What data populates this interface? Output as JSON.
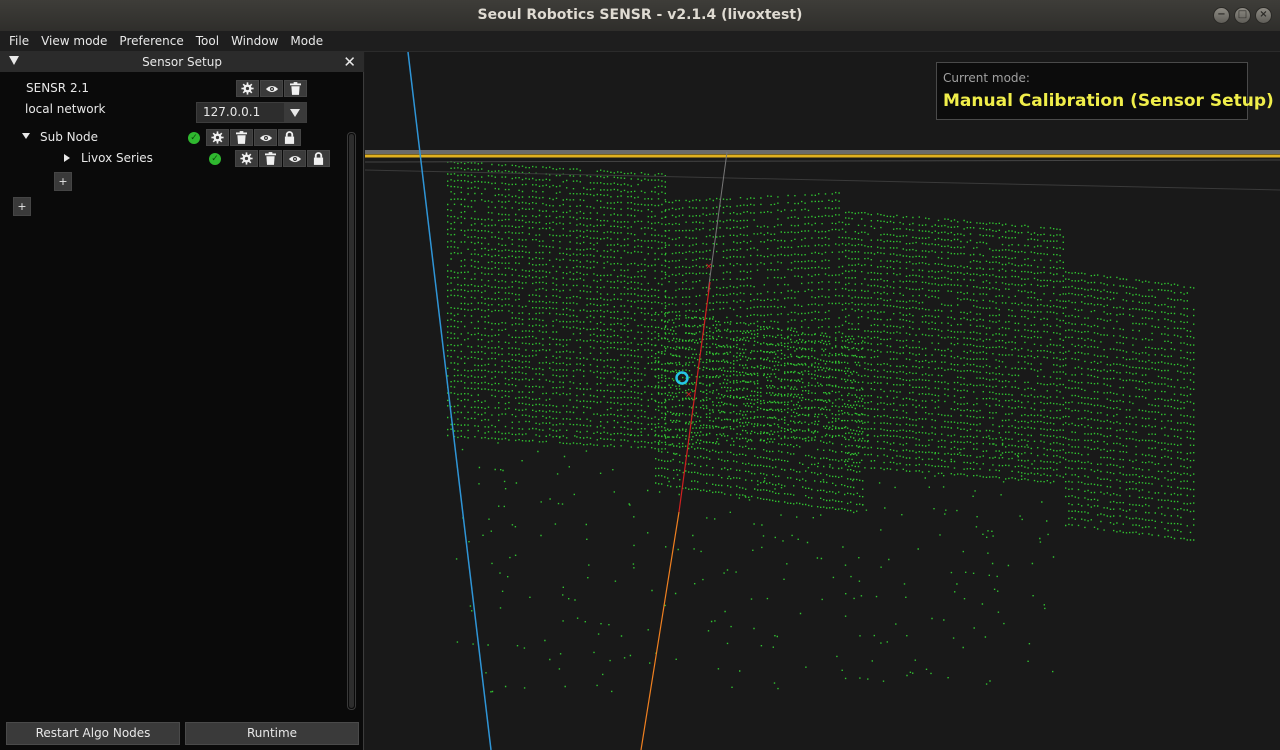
{
  "window": {
    "title": "Seoul Robotics SENSR - v2.1.4   (livoxtest)"
  },
  "menubar": {
    "items": [
      "File",
      "View mode",
      "Preference",
      "Tool",
      "Window",
      "Mode"
    ]
  },
  "panel": {
    "title": "Sensor Setup",
    "root_label": "SENSR 2.1",
    "network_label": "local network",
    "ip_value": "127.0.0.1",
    "sub_node_label": "Sub Node",
    "sensor_label": "Livox Series",
    "add_label": "+",
    "restart_label": "Restart Algo Nodes",
    "runtime_label": "Runtime"
  },
  "viewport": {
    "mode_label": "Current mode:",
    "mode_value": "Manual Calibration (Sensor Setup)"
  },
  "colors": {
    "point_cloud": "#31c431",
    "mode_text": "#f0ee4a",
    "axis_blue": "#2f95d6",
    "axis_red": "#d02020",
    "status_ok": "#2fb82f",
    "marker": "#25c6e6"
  },
  "icons": [
    "gear-icon",
    "eye-icon",
    "trash-icon",
    "lock-icon",
    "check-icon",
    "close-icon"
  ]
}
